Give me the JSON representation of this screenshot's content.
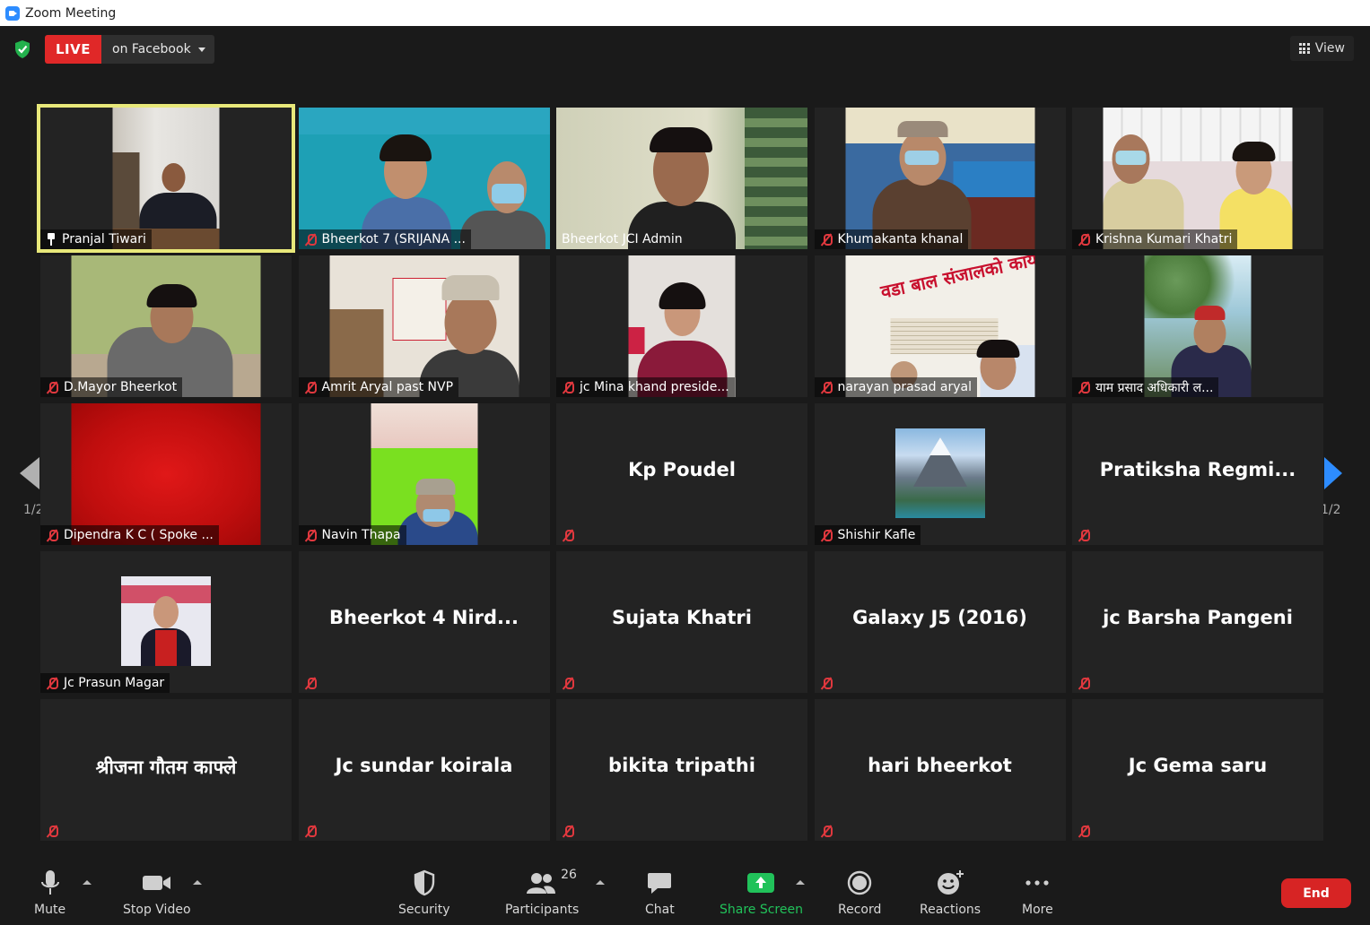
{
  "window": {
    "title": "Zoom Meeting"
  },
  "topbar": {
    "live_label": "LIVE",
    "live_target": "on Facebook",
    "view_label": "View"
  },
  "pagination": {
    "left": "1/2",
    "right": "1/2"
  },
  "tiles": [
    {
      "name": "Pranjal Tiwari",
      "video": true,
      "pinned": true,
      "active": true
    },
    {
      "name": "Bheerkot 7 (SRIJANA ...",
      "video": true,
      "muted": true
    },
    {
      "name": "Bheerkot JCI Admin",
      "video": true
    },
    {
      "name": "Khumakanta khanal",
      "video": true,
      "muted": true
    },
    {
      "name": "Krishna Kumari Khatri",
      "video": true,
      "muted": true
    },
    {
      "name": "D.Mayor Bheerkot",
      "video": true,
      "muted": true
    },
    {
      "name": "Amrit Aryal past NVP",
      "video": true,
      "muted": true
    },
    {
      "name": "jc Mina khand preside...",
      "video": true,
      "muted": true
    },
    {
      "name": "narayan prasad aryal",
      "video": true,
      "muted": true,
      "poster_text": "वडा बाल संजालको कार्यालय"
    },
    {
      "name": "याम प्रसाद अधिकारी ल...",
      "video": true,
      "muted": true
    },
    {
      "name": "Dipendra K C ( Spoke ...",
      "video": true,
      "muted": true
    },
    {
      "name": "Navin Thapa",
      "video": true,
      "muted": true
    },
    {
      "display": "Kp Poudel",
      "muted": true
    },
    {
      "name": "Shishir Kafle",
      "avatar": true,
      "muted": true
    },
    {
      "display": "Pratiksha  Regmi...",
      "muted": true
    },
    {
      "name": "Jc Prasun Magar",
      "avatar": true,
      "muted": true
    },
    {
      "display": "Bheerkot 4 Nird...",
      "muted": true
    },
    {
      "display": "Sujata Khatri",
      "muted": true
    },
    {
      "display": "Galaxy J5 (2016)",
      "muted": true
    },
    {
      "display": "jc Barsha Pangeni",
      "muted": true
    },
    {
      "display": "श्रीजना गौतम काफ्ले",
      "muted": true
    },
    {
      "display": "Jc sundar koirala",
      "muted": true
    },
    {
      "display": "bikita tripathi",
      "muted": true
    },
    {
      "display": "hari bheerkot",
      "muted": true
    },
    {
      "display": "Jc Gema saru",
      "muted": true
    }
  ],
  "toolbar": {
    "mute": "Mute",
    "stop_video": "Stop Video",
    "security": "Security",
    "participants": "Participants",
    "participants_count": "26",
    "chat": "Chat",
    "share_screen": "Share Screen",
    "record": "Record",
    "reactions": "Reactions",
    "more": "More",
    "end": "End"
  },
  "colors": {
    "active_speaker": "#e8e87a",
    "live": "#e02828",
    "share": "#21c25a",
    "end": "#d72424",
    "muted": "#e0383e",
    "accent": "#2d8cff"
  }
}
